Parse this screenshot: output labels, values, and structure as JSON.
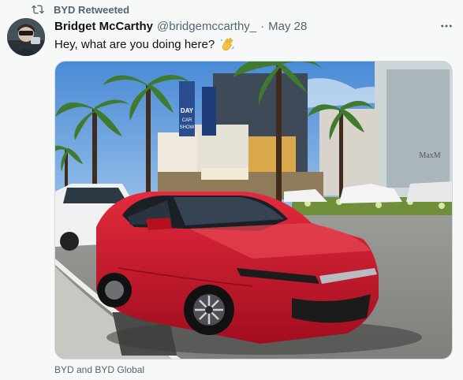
{
  "retweet": {
    "icon": "retweet-icon",
    "label": "BYD Retweeted"
  },
  "author": {
    "name": "Bridget McCarthy",
    "handle": "@bridgemccarthy_",
    "separator": "·",
    "date": "May 28"
  },
  "tweet": {
    "text": "Hey, what are you doing here?",
    "emoji": "waving-hand-emoji"
  },
  "media": {
    "description_icon": "photo",
    "signs": {
      "banner_day": "DAY",
      "banner_show": "SHOW",
      "banner_car": "CAR",
      "store_name": "MaxM"
    }
  },
  "tagged": "BYD and BYD Global",
  "colors": {
    "text_primary": "#0f1419",
    "text_secondary": "#536471",
    "background": "#f7f9f9",
    "border": "#cfd9de",
    "car_red": "#c8142a"
  }
}
